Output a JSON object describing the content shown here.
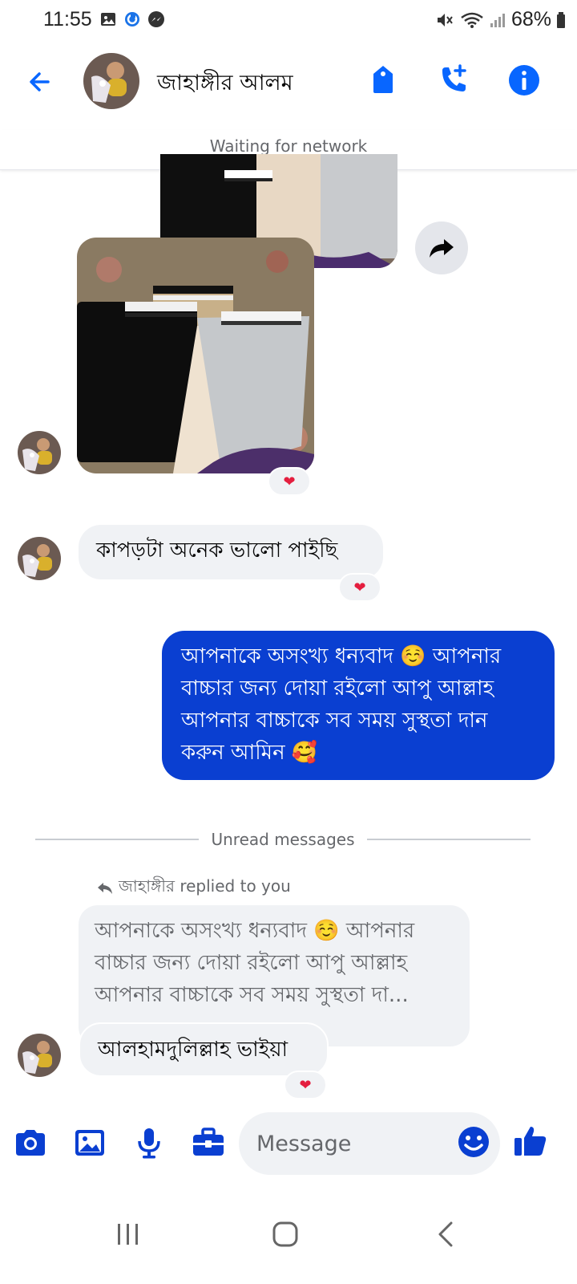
{
  "status_bar": {
    "time": "11:55",
    "battery": "68%"
  },
  "header": {
    "contact_name": "জাহাঙ্গীর আলম",
    "network_status": "Waiting for network"
  },
  "messages": {
    "incoming_1": "কাপড়টা অনেক ভালো পাইছি",
    "outgoing_1": "আপনাকে অসংখ্য ধন্যবাদ ☺️ আপনার বাচ্চার জন্য দোয়া রইলো আপু আল্লাহ আপনার বাচ্চাকে সব সময় সুস্থতা দান করুন আমিন 🥰",
    "unread_divider": "Unread messages",
    "reply_label": "জাহাঙ্গীর replied to you",
    "quoted_text": "আপনাকে অসংখ্য ধন্যবাদ ☺️ আপনার বাচ্চার জন্য দোয়া রইলো আপু আল্লাহ আপনার বাচ্চাকে সব সময় সুস্থতা দা...",
    "incoming_2": "আলহামদুলিল্লাহ ভাইয়া",
    "reaction": "❤"
  },
  "composer": {
    "placeholder": "Message"
  },
  "colors": {
    "accent": "#0866ff",
    "outgoing_bubble": "#0a3fd1",
    "incoming_bubble": "#f0f2f5"
  }
}
